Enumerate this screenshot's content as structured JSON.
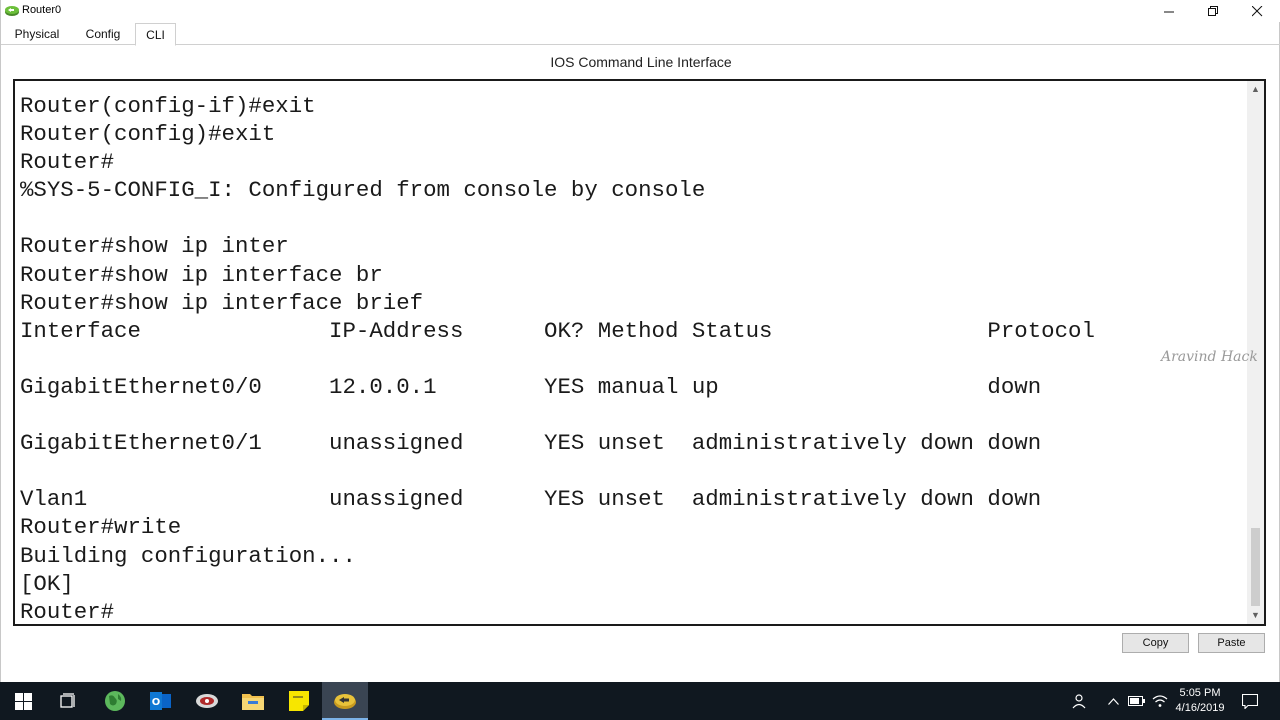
{
  "window": {
    "title": "Router0",
    "icon": "router-icon",
    "controls": [
      "minimize-icon",
      "restore-icon",
      "close-icon"
    ]
  },
  "tabs": [
    {
      "label": "Physical",
      "active": false
    },
    {
      "label": "Config",
      "active": false
    },
    {
      "label": "CLI",
      "active": true
    }
  ],
  "cli": {
    "header": "IOS Command Line Interface",
    "lines": [
      "Router(config-if)#exit",
      "Router(config)#exit",
      "Router#",
      "%SYS-5-CONFIG_I: Configured from console by console",
      "",
      "Router#show ip inter",
      "Router#show ip interface br",
      "Router#show ip interface brief",
      "Interface              IP-Address      OK? Method Status                Protocol",
      "",
      "GigabitEthernet0/0     12.0.0.1        YES manual up                    down",
      "",
      "GigabitEthernet0/1     unassigned      YES unset  administratively down down",
      "",
      "Vlan1                  unassigned      YES unset  administratively down down",
      "Router#write",
      "Building configuration...",
      "[OK]",
      "Router#"
    ],
    "watermark": "Aravind Hack"
  },
  "buttons": {
    "copy": "Copy",
    "paste": "Paste"
  },
  "taskbar": {
    "apps": [
      "windows-start-icon",
      "task-view-icon",
      "globe-icon",
      "outlook-icon",
      "network-tool-icon",
      "file-explorer-icon",
      "sticky-notes-icon",
      "packet-tracer-icon"
    ],
    "tray": [
      "people-icon",
      "chevron-up-icon",
      "battery-icon",
      "wifi-icon",
      "network-icon",
      "notifications-icon"
    ],
    "time": "5:05 PM",
    "date": "4/16/2019"
  },
  "colors": {
    "taskbar": "#101820",
    "frame_border": "#1a1a1a"
  }
}
